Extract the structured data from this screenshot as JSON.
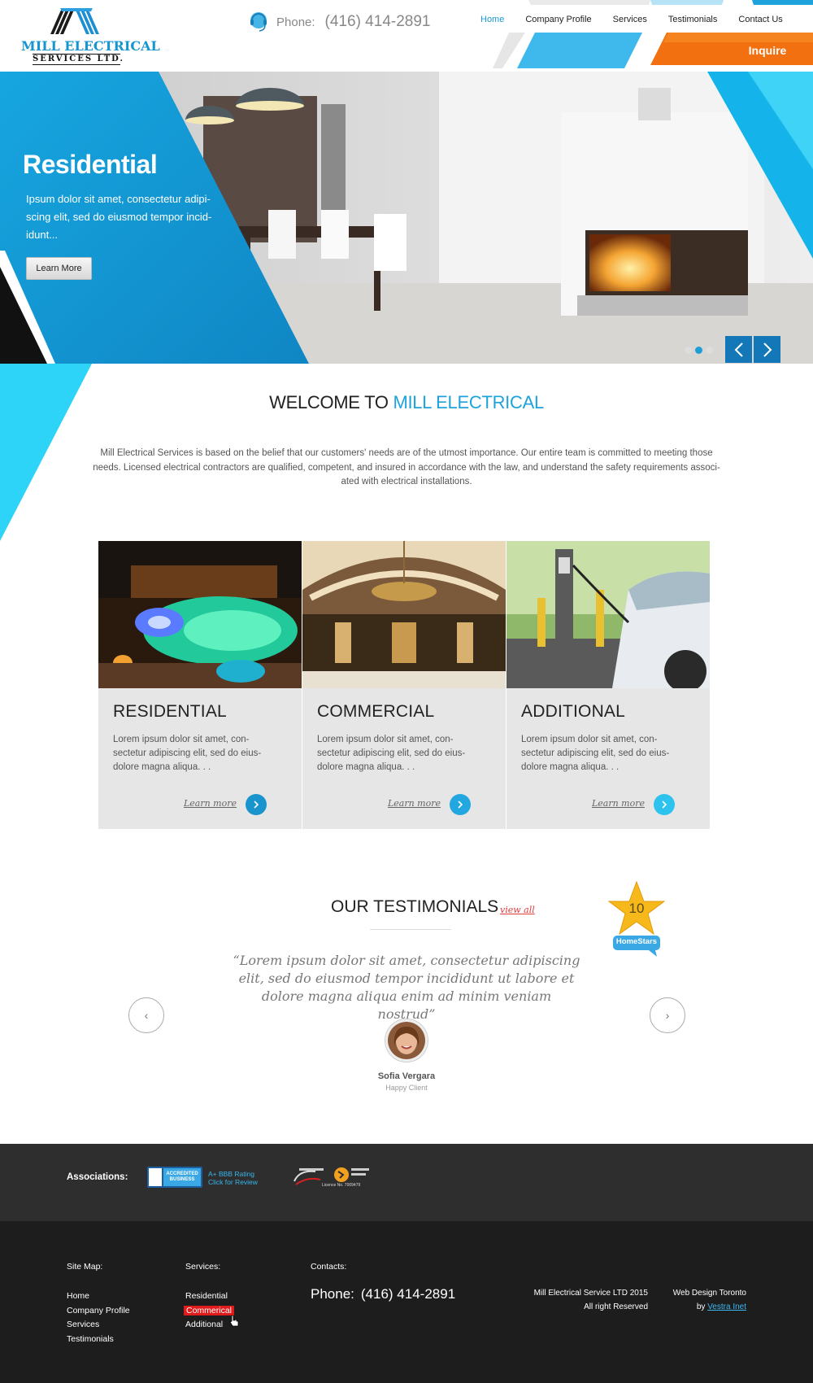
{
  "logo": {
    "line1": "MILL ELECTRICAL",
    "line2": "SERVICES LTD."
  },
  "header": {
    "phone_label": "Phone:",
    "phone_number": "(416) 414-2891",
    "nav": [
      "Home",
      "Company Profile",
      "Services",
      "Testimonials",
      "Contact Us"
    ],
    "active_nav": "Home",
    "inquire_label": "Inquire"
  },
  "hero": {
    "title": "Residential",
    "text": "Ipsum dolor sit amet, consectetur adipi-scing elit, sed do eiusmod tempor incid-idunt...",
    "button_label": "Learn More",
    "slides": 3,
    "active_slide": 2,
    "prev_icon": "chevron-left-icon",
    "next_icon": "chevron-right-icon"
  },
  "welcome": {
    "title_prefix": "WELCOME TO",
    "title_highlight": "MILL ELECTRICAL",
    "text": "Mill Electrical Services is based on the belief that our customers' needs are of the utmost importance. Our entire team is committed to meeting those needs. Licensed electrical contractors are qualified, competent, and insured in accordance with the law, and understand the safety requirements associ-ated with electrical installations."
  },
  "services": [
    {
      "title": "RESIDENTIAL",
      "text": "Lorem ipsum dolor sit amet, con-sectetur adipiscing elit, sed do eius-dolore magna aliqua. . .",
      "link": "Learn more"
    },
    {
      "title": "COMMERCIAL",
      "text": "Lorem ipsum dolor sit amet, con-sectetur adipiscing elit, sed do eius-dolore magna aliqua. . .",
      "link": "Learn more"
    },
    {
      "title": "ADDITIONAL",
      "text": "Lorem ipsum dolor sit amet, con-sectetur adipiscing elit, sed do eius-dolore magna aliqua. . .",
      "link": "Learn more"
    }
  ],
  "testimonials": {
    "title": "OUR TESTIMONIALS",
    "view_all": "view all",
    "badge_number": "10",
    "badge_label": "HomeStars",
    "quote": "“Lorem ipsum dolor sit amet, consectetur adipiscing elit, sed do eiusmod tempor incididunt ut labore et dolore magna aliqua enim ad minim veniam nostrud”",
    "name": "Sofia Vergara",
    "role": "Happy Client",
    "prev": "‹",
    "next": "›"
  },
  "associations": {
    "label": "Associations:",
    "bbb_badge": "ACCREDITED BUSINESS",
    "bbb_line1": "A+ BBB Rating",
    "bbb_line2": "Click for Review",
    "esa_text": "Licence No. 7009479"
  },
  "footer": {
    "sitemap_title": "Site Map:",
    "sitemap": [
      "Home",
      "Company Profile",
      "Services",
      "Testimonials"
    ],
    "services_title": "Services:",
    "services": [
      "Residential",
      "Commerical",
      "Additional"
    ],
    "highlighted_service": "Commerical",
    "contacts_title": "Contacts:",
    "phone_label": "Phone:",
    "phone_number": "(416) 414-2891",
    "copyright_line1": "Mill Electrical Service LTD 2015",
    "copyright_line2": "All right Reserved",
    "webdesign_line1": "Web Design Toronto",
    "webdesign_by": "by",
    "webdesign_link": "Vestra Inet"
  },
  "colors": {
    "brand_blue": "#1ea2dc",
    "orange": "#f26a0f",
    "dark": "#2e2e2e",
    "footer": "#1d1d1d",
    "highlight_red": "#e01b1b"
  }
}
